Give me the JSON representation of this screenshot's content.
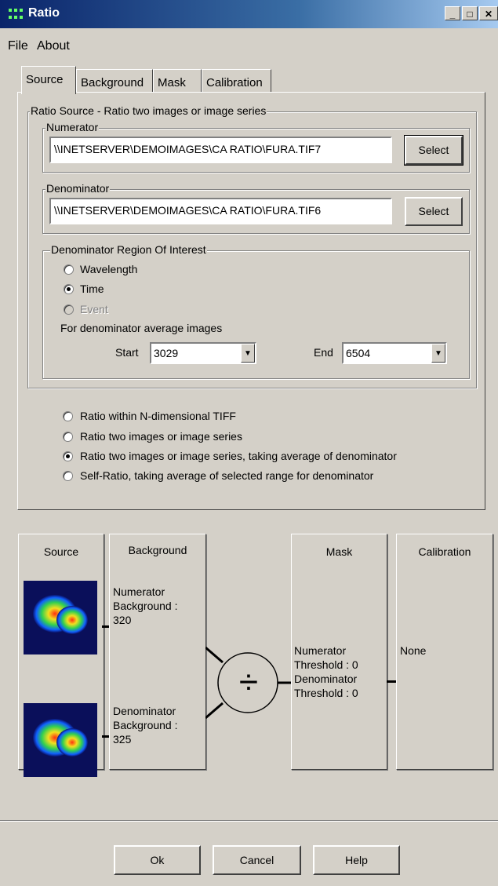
{
  "window": {
    "title": "Ratio"
  },
  "menu": {
    "file": "File",
    "about": "About"
  },
  "tabs": [
    "Source",
    "Background",
    "Mask",
    "Calibration"
  ],
  "source_group": {
    "title": "Ratio Source - Ratio two images or image series",
    "numerator": {
      "label": "Numerator",
      "value": "\\\\INETSERVER\\DEMOIMAGES\\CA RATIO\\FURA.TIF7",
      "button": "Select"
    },
    "denominator": {
      "label": "Denominator",
      "value": "\\\\INETSERVER\\DEMOIMAGES\\CA RATIO\\FURA.TIF6",
      "button": "Select"
    },
    "roi": {
      "title": "Denominator Region Of Interest",
      "options": [
        "Wavelength",
        "Time",
        "Event"
      ],
      "selected": "Time",
      "avg_label": "For denominator average images",
      "start_label": "Start",
      "start_value": "3029",
      "end_label": "End",
      "end_value": "6504"
    }
  },
  "ratio_modes": [
    "Ratio within N-dimensional TIFF",
    "Ratio two images or image series",
    "Ratio two images or image series, taking average of denominator",
    "Self-Ratio, taking average of selected range for denominator"
  ],
  "ratio_mode_selected": 2,
  "flow": {
    "source_title": "Source",
    "background_title": "Background",
    "numerator_bg": [
      "Numerator",
      "Background :",
      "320"
    ],
    "denominator_bg": [
      "Denominator",
      "Background :",
      "325"
    ],
    "mask_title": "Mask",
    "mask_text": [
      "Numerator",
      "Threshold : 0",
      "Denominator",
      "Threshold : 0"
    ],
    "calibration_title": "Calibration",
    "calibration_text": "None",
    "divide_symbol": "÷"
  },
  "buttons": {
    "ok": "Ok",
    "cancel": "Cancel",
    "help": "Help"
  }
}
